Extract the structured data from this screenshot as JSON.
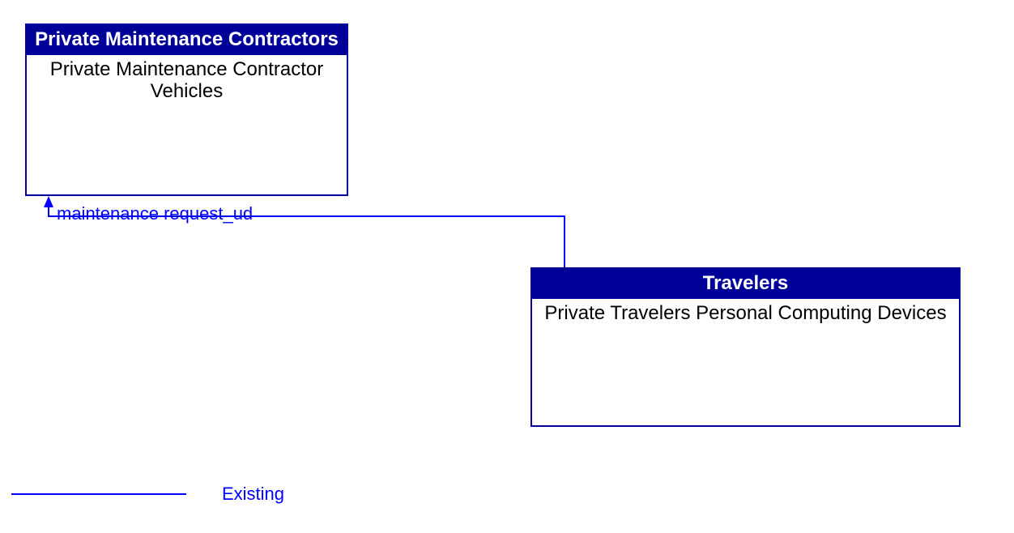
{
  "boxes": {
    "top_left": {
      "header": "Private Maintenance Contractors",
      "body": "Private Maintenance Contractor Vehicles"
    },
    "bottom_right": {
      "header": "Travelers",
      "body": "Private Travelers Personal Computing Devices"
    }
  },
  "flow": {
    "label": "maintenance request_ud"
  },
  "legend": {
    "label": "Existing"
  },
  "colors": {
    "line": "#0000ff",
    "box_border": "#000099",
    "header_bg": "#000099"
  }
}
